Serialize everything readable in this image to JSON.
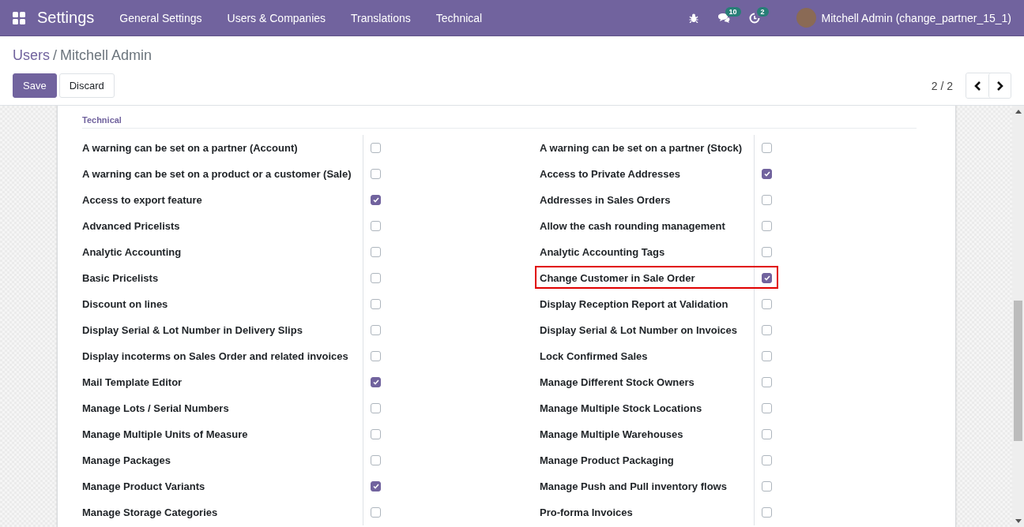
{
  "navbar": {
    "app_title": "Settings",
    "menus": [
      "General Settings",
      "Users & Companies",
      "Translations",
      "Technical"
    ],
    "messages_count": "10",
    "activities_count": "2",
    "user_name": "Mitchell Admin (change_partner_15_1)"
  },
  "breadcrumb": {
    "parent": "Users",
    "separator": "/",
    "current": "Mitchell Admin"
  },
  "buttons": {
    "save": "Save",
    "discard": "Discard"
  },
  "pager": {
    "value": "2 / 2"
  },
  "group": {
    "title": "Technical",
    "left": [
      {
        "label": "A warning can be set on a partner (Account)",
        "checked": false,
        "highlighted": false
      },
      {
        "label": "A warning can be set on a product or a customer (Sale)",
        "checked": false,
        "highlighted": false
      },
      {
        "label": "Access to export feature",
        "checked": true,
        "highlighted": false
      },
      {
        "label": "Advanced Pricelists",
        "checked": false,
        "highlighted": false
      },
      {
        "label": "Analytic Accounting",
        "checked": false,
        "highlighted": false
      },
      {
        "label": "Basic Pricelists",
        "checked": false,
        "highlighted": false
      },
      {
        "label": "Discount on lines",
        "checked": false,
        "highlighted": false
      },
      {
        "label": "Display Serial & Lot Number in Delivery Slips",
        "checked": false,
        "highlighted": false
      },
      {
        "label": "Display incoterms on Sales Order and related invoices",
        "checked": false,
        "highlighted": false
      },
      {
        "label": "Mail Template Editor",
        "checked": true,
        "highlighted": false
      },
      {
        "label": "Manage Lots / Serial Numbers",
        "checked": false,
        "highlighted": false
      },
      {
        "label": "Manage Multiple Units of Measure",
        "checked": false,
        "highlighted": false
      },
      {
        "label": "Manage Packages",
        "checked": false,
        "highlighted": false
      },
      {
        "label": "Manage Product Variants",
        "checked": true,
        "highlighted": false
      },
      {
        "label": "Manage Storage Categories",
        "checked": false,
        "highlighted": false
      }
    ],
    "right": [
      {
        "label": "A warning can be set on a partner (Stock)",
        "checked": false,
        "highlighted": false
      },
      {
        "label": "Access to Private Addresses",
        "checked": true,
        "highlighted": false
      },
      {
        "label": "Addresses in Sales Orders",
        "checked": false,
        "highlighted": false
      },
      {
        "label": "Allow the cash rounding management",
        "checked": false,
        "highlighted": false
      },
      {
        "label": "Analytic Accounting Tags",
        "checked": false,
        "highlighted": false
      },
      {
        "label": "Change Customer in Sale Order",
        "checked": true,
        "highlighted": true
      },
      {
        "label": "Display Reception Report at Validation",
        "checked": false,
        "highlighted": false
      },
      {
        "label": "Display Serial & Lot Number on Invoices",
        "checked": false,
        "highlighted": false
      },
      {
        "label": "Lock Confirmed Sales",
        "checked": false,
        "highlighted": false
      },
      {
        "label": "Manage Different Stock Owners",
        "checked": false,
        "highlighted": false
      },
      {
        "label": "Manage Multiple Stock Locations",
        "checked": false,
        "highlighted": false
      },
      {
        "label": "Manage Multiple Warehouses",
        "checked": false,
        "highlighted": false
      },
      {
        "label": "Manage Product Packaging",
        "checked": false,
        "highlighted": false
      },
      {
        "label": "Manage Push and Pull inventory flows",
        "checked": false,
        "highlighted": false
      },
      {
        "label": "Pro-forma Invoices",
        "checked": false,
        "highlighted": false
      }
    ]
  }
}
